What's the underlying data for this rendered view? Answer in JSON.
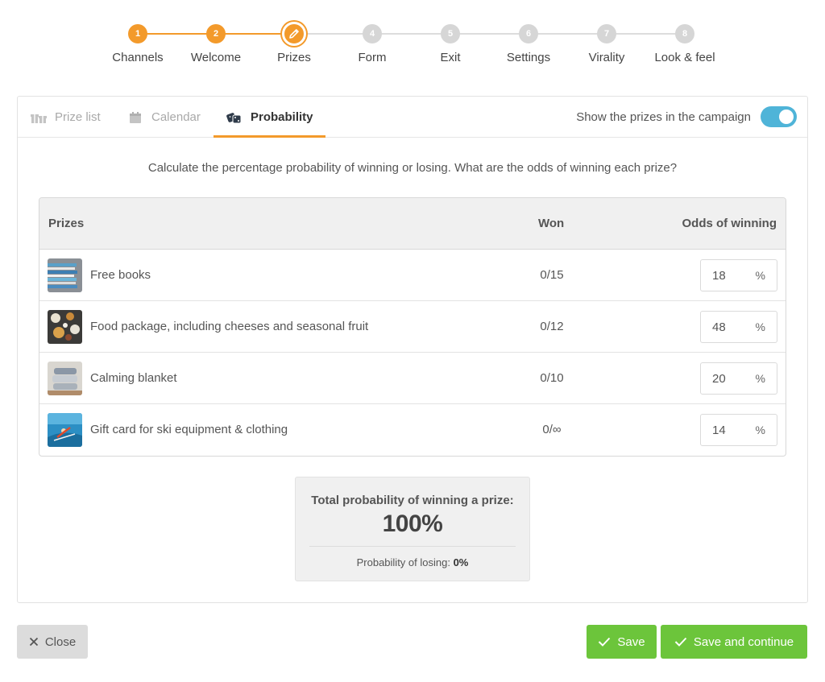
{
  "stepper": {
    "steps": [
      {
        "number": "1",
        "label": "Channels"
      },
      {
        "number": "2",
        "label": "Welcome"
      },
      {
        "number": "",
        "label": "Prizes"
      },
      {
        "number": "4",
        "label": "Form"
      },
      {
        "number": "5",
        "label": "Exit"
      },
      {
        "number": "6",
        "label": "Settings"
      },
      {
        "number": "7",
        "label": "Virality"
      },
      {
        "number": "8",
        "label": "Look & feel"
      }
    ],
    "active_icon": "pencil-icon",
    "accent_color": "#f39a2b"
  },
  "tabs": {
    "items": [
      {
        "label": "Prize list",
        "icon": "gifts-icon"
      },
      {
        "label": "Calendar",
        "icon": "calendar-icon"
      },
      {
        "label": "Probability",
        "icon": "dice-icon"
      }
    ],
    "active": "Probability",
    "show_prizes_label": "Show the prizes in the campaign",
    "show_prizes_enabled": true,
    "toggle_color": "#4fb4d8"
  },
  "intro": "Calculate the percentage probability of winning or losing. What are the odds of winning each prize?",
  "table": {
    "headers": {
      "prizes": "Prizes",
      "won": "Won",
      "odds": "Odds of winning"
    },
    "rows": [
      {
        "name": "Free books",
        "won": "0/15",
        "odds": "18",
        "unit": "%",
        "thumb": "books-image"
      },
      {
        "name": "Food package, including cheeses and seasonal fruit",
        "won": "0/12",
        "odds": "48",
        "unit": "%",
        "thumb": "food-image"
      },
      {
        "name": "Calming blanket",
        "won": "0/10",
        "odds": "20",
        "unit": "%",
        "thumb": "blanket-image"
      },
      {
        "name": "Gift card for ski equipment & clothing",
        "won": "0/∞",
        "odds": "14",
        "unit": "%",
        "thumb": "ski-image"
      }
    ]
  },
  "summary": {
    "title": "Total probability of winning a prize:",
    "total": "100%",
    "losing_label": "Probability of losing:",
    "losing_value": "0%"
  },
  "footer": {
    "close_label": "Close",
    "save_label": "Save",
    "save_continue_label": "Save and continue",
    "save_color": "#6cc53b"
  }
}
